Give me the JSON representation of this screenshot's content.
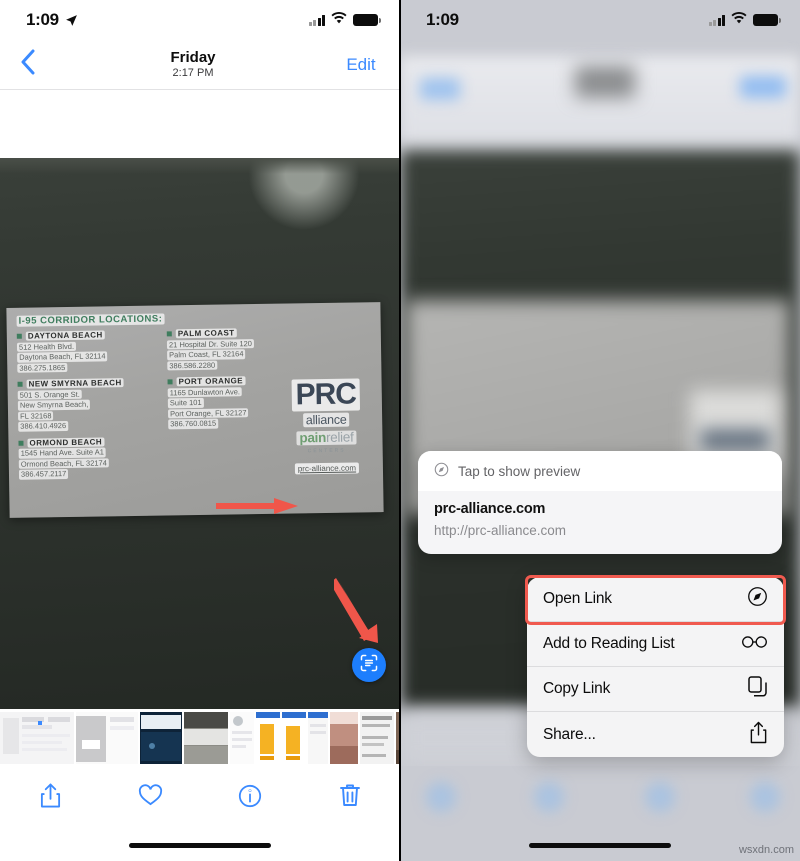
{
  "left_panel": {
    "status_bar": {
      "time": "1:09",
      "location_icon": "location-arrow-icon",
      "signal_icon": "cellular-signal-icon",
      "wifi_icon": "wifi-icon",
      "battery_icon": "battery-icon"
    },
    "nav_bar": {
      "back_icon": "chevron-left-icon",
      "day": "Friday",
      "time": "2:17 PM",
      "edit_label": "Edit"
    },
    "photo": {
      "card": {
        "heading": "I-95 CORRIDOR LOCATIONS:",
        "locations": [
          {
            "name": "DAYTONA BEACH",
            "lines": [
              "512 Health Blvd.",
              "Daytona Beach, FL 32114",
              "386.275.1865"
            ]
          },
          {
            "name": "PALM COAST",
            "lines": [
              "21 Hospital Dr. Suite 120",
              "Palm Coast, FL 32164",
              "386.586.2280"
            ]
          },
          {
            "name": "NEW SMYRNA BEACH",
            "lines": [
              "501 S. Orange St.",
              "New Smyrna Beach,",
              "FL 32168",
              "386.410.4926"
            ]
          },
          {
            "name": "PORT ORANGE",
            "lines": [
              "1165 Dunlawton Ave.",
              "Suite 101",
              "Port Orange, FL 32127",
              "386.760.0815"
            ]
          },
          {
            "name": "ORMOND BEACH",
            "lines": [
              "1545 Hand Ave. Suite A1",
              "Ormond Beach, FL 32174",
              "386.457.2117"
            ]
          }
        ],
        "logo": {
          "word": "PRC",
          "alliance": "alliance",
          "pain": "pain",
          "relief": "relief",
          "centers": "CENTERS",
          "url": "prc-alliance.com"
        }
      },
      "live_text_button": "live-text-scan-icon",
      "arrow_url": "red-arrow-right",
      "arrow_button": "red-arrow-down-right"
    },
    "toolbar": {
      "share_icon": "share-icon",
      "favorite_icon": "heart-icon",
      "info_icon": "info-icon",
      "delete_icon": "trash-icon"
    }
  },
  "right_panel": {
    "status_bar": {
      "time": "1:09",
      "signal_icon": "cellular-signal-icon",
      "wifi_icon": "wifi-icon",
      "battery_icon": "battery-icon"
    },
    "preview_card": {
      "preview_icon": "safari-compass-icon",
      "preview_label": "Tap to show preview",
      "title": "prc-alliance.com",
      "url": "http://prc-alliance.com"
    },
    "context_menu": {
      "items": [
        {
          "label": "Open Link",
          "icon": "safari-compass-icon",
          "highlighted": true
        },
        {
          "label": "Add to Reading List",
          "icon": "glasses-icon",
          "highlighted": false
        },
        {
          "label": "Copy Link",
          "icon": "copy-documents-icon",
          "highlighted": false
        },
        {
          "label": "Share...",
          "icon": "share-icon",
          "highlighted": false
        }
      ]
    }
  },
  "watermark": "wsxdn.com",
  "colors": {
    "accent_blue": "#3b8aff",
    "live_text_blue": "#1d7efd",
    "annotation_red": "#f0564a",
    "card_green": "#3f7d5e"
  }
}
